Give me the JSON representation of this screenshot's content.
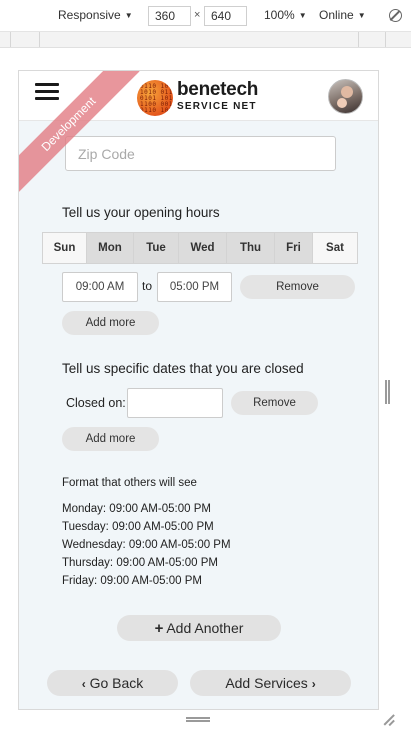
{
  "devtools": {
    "device_mode": "Responsive",
    "width": "360",
    "times": "×",
    "height": "640",
    "zoom": "100%",
    "throttle": "Online"
  },
  "header": {
    "brand_name": "benetech",
    "brand_sub": "SERVICE NET",
    "logo_bits": "0110 1001\n1010 0110\n0101 1010\n1100 0011\n0110 1001",
    "ribbon": "Development"
  },
  "form": {
    "zip_placeholder": "Zip Code",
    "opening_hours_label": "Tell us your opening hours",
    "days": [
      "Sun",
      "Mon",
      "Tue",
      "Wed",
      "Thu",
      "Fri",
      "Sat"
    ],
    "active_days": [
      "Mon",
      "Tue",
      "Wed",
      "Thu",
      "Fri"
    ],
    "open_time": "09:00 AM",
    "to_label": "to",
    "close_time": "05:00 PM",
    "remove_label": "Remove",
    "add_more_label": "Add more",
    "closed_dates_label": "Tell us specific dates that you are closed",
    "closed_on_label": "Closed on:",
    "closed_remove_label": "Remove",
    "closed_add_more_label": "Add more",
    "format_heading": "Format that others will see",
    "format_lines": [
      "Monday: 09:00 AM-05:00 PM",
      "Tuesday: 09:00 AM-05:00 PM",
      "Wednesday: 09:00 AM-05:00 PM",
      "Thursday: 09:00 AM-05:00 PM",
      "Friday: 09:00 AM-05:00 PM"
    ],
    "add_another_label": "Add Another",
    "go_back_label": "Go Back",
    "add_services_label": "Add Services"
  }
}
